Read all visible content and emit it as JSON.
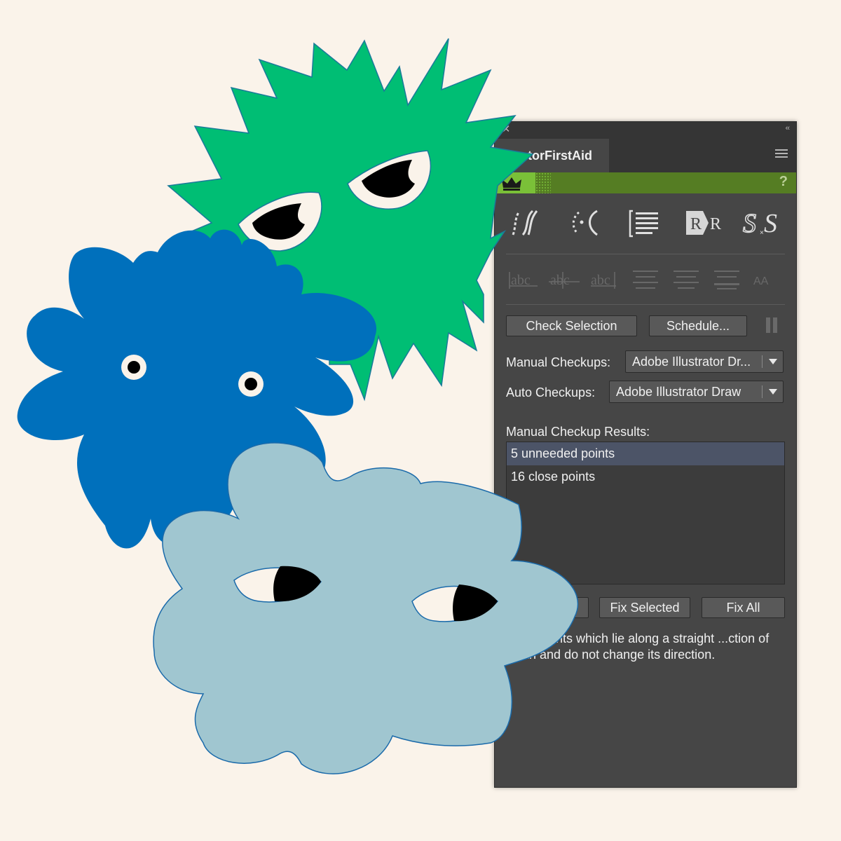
{
  "panel": {
    "title": "VectorFirstAid",
    "help_glyph": "?",
    "collapse_glyph": "‹‹",
    "close_glyph": "✕",
    "buttons": {
      "check_selection": "Check Selection",
      "schedule": "Schedule...",
      "fix_selected": "Fix Selected",
      "fix_all": "Fix All"
    },
    "manual_checkups": {
      "label": "Manual Checkups:",
      "value": "Adobe Illustrator Dr..."
    },
    "auto_checkups": {
      "label": "Auto Checkups:",
      "value": "Adobe Illustrator Draw"
    },
    "results": {
      "label": "Manual Checkup Results:",
      "items": [
        {
          "text": "5 unneeded points",
          "selected": true
        },
        {
          "text": "16 close points",
          "selected": false
        }
      ]
    },
    "description": "...ve points which lie along a straight ...ction of path and do not change its direction.",
    "tools_row1": [
      "smooth-path-icon",
      "broken-path-icon",
      "text-align-icon",
      "replace-font-icon",
      "swap-style-icon"
    ],
    "tools_row2_text": {
      "abc": "abc",
      "aa": "AA"
    },
    "colors": {
      "panel_bg": "#464646",
      "accent_green": "#557D23",
      "crown_green": "#7AC038",
      "selected_row": "#4C5467"
    }
  },
  "artboard": {
    "background": "#FAF3EA",
    "monster_colors": {
      "green": "#00BE74",
      "blue": "#0070BC",
      "light_blue": "#A0C6D0"
    }
  }
}
